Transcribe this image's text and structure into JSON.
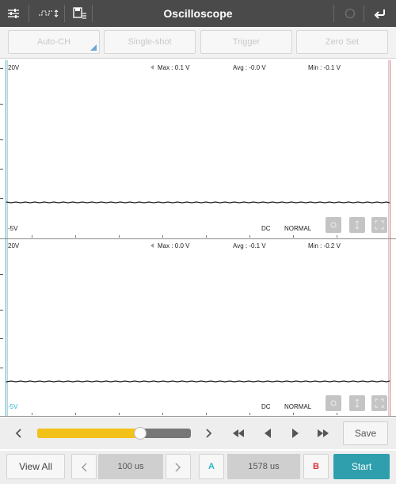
{
  "header": {
    "title": "Oscilloscope",
    "icons": [
      "settings-sliders-icon",
      "waveform-icon",
      "save-menu-icon",
      "refresh-icon",
      "back-icon"
    ]
  },
  "toolbar": {
    "auto_ch": "Auto-CH",
    "single_shot": "Single-shot",
    "trigger": "Trigger",
    "zero_set": "Zero Set"
  },
  "channel1": {
    "top_label": "20V",
    "bottom_label": "-5V",
    "max": "Max : 0.1 V",
    "avg": "Avg : -0.0 V",
    "min": "Min : -0.1 V",
    "coupling": "DC",
    "mode": "NORMAL"
  },
  "channel2": {
    "top_label": "20V",
    "bottom_label": "-5V",
    "max": "Max : 0.0 V",
    "avg": "Avg : -0.1 V",
    "min": "Min : -0.2 V",
    "coupling": "DC",
    "mode": "NORMAL"
  },
  "playback": {
    "slider_value": 0.67,
    "save_label": "Save"
  },
  "bottom_bar": {
    "view_all": "View All",
    "time_div": "100 us",
    "cursor_a": "A",
    "cursor_delta": "1578 us",
    "cursor_b": "B",
    "start": "Start"
  },
  "colors": {
    "header_bg": "#4a4a4a",
    "channel_a": "#2bb5c7",
    "channel_b": "#d9303a",
    "slider_fill": "#f3c21a",
    "start_bg": "#2f9fae"
  }
}
